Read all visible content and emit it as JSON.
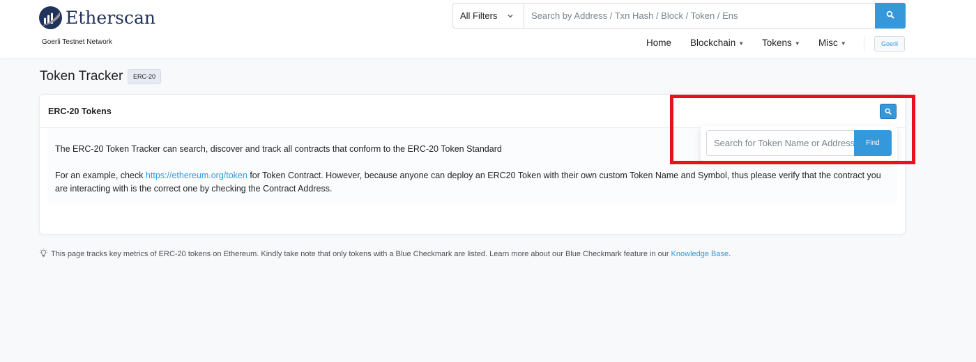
{
  "header": {
    "brand": "Etherscan",
    "network": "Goerli Testnet Network",
    "search": {
      "filter_label": "All Filters",
      "placeholder": "Search by Address / Txn Hash / Block / Token / Ens"
    },
    "nav": [
      {
        "label": "Home",
        "has_caret": false
      },
      {
        "label": "Blockchain",
        "has_caret": true
      },
      {
        "label": "Tokens",
        "has_caret": true
      },
      {
        "label": "Misc",
        "has_caret": true
      }
    ],
    "network_badge": "Goerli"
  },
  "page": {
    "title": "Token Tracker",
    "badge": "ERC-20"
  },
  "card": {
    "title": "ERC-20 Tokens",
    "intro": "The ERC-20 Token Tracker can search, discover and track all contracts that conform to the ERC-20 Token Standard",
    "example_prefix": "For an example, check ",
    "example_link": "https://ethereum.org/token",
    "example_suffix": " for Token Contract. However, because anyone can deploy an ERC20 Token with their own custom Token Name and Symbol, thus please verify that the contract you are interacting with is the correct one by checking the Contract Address.",
    "token_search_placeholder": "Search for Token Name or Address",
    "find_label": "Find"
  },
  "footer": {
    "note": "This page tracks key metrics of ERC-20 tokens on Ethereum. Kindly take note that only tokens with a Blue Checkmark are listed. Learn more about our Blue Checkmark feature in our",
    "link": "Knowledge Base",
    "suffix": "."
  },
  "colors": {
    "accent": "#3498db",
    "brand": "#21325b",
    "highlight": "#e8121b",
    "background": "#f8f9fa"
  },
  "icons": [
    "etherscan-logo-icon",
    "chevron-down-icon",
    "search-icon",
    "lightbulb-icon"
  ]
}
